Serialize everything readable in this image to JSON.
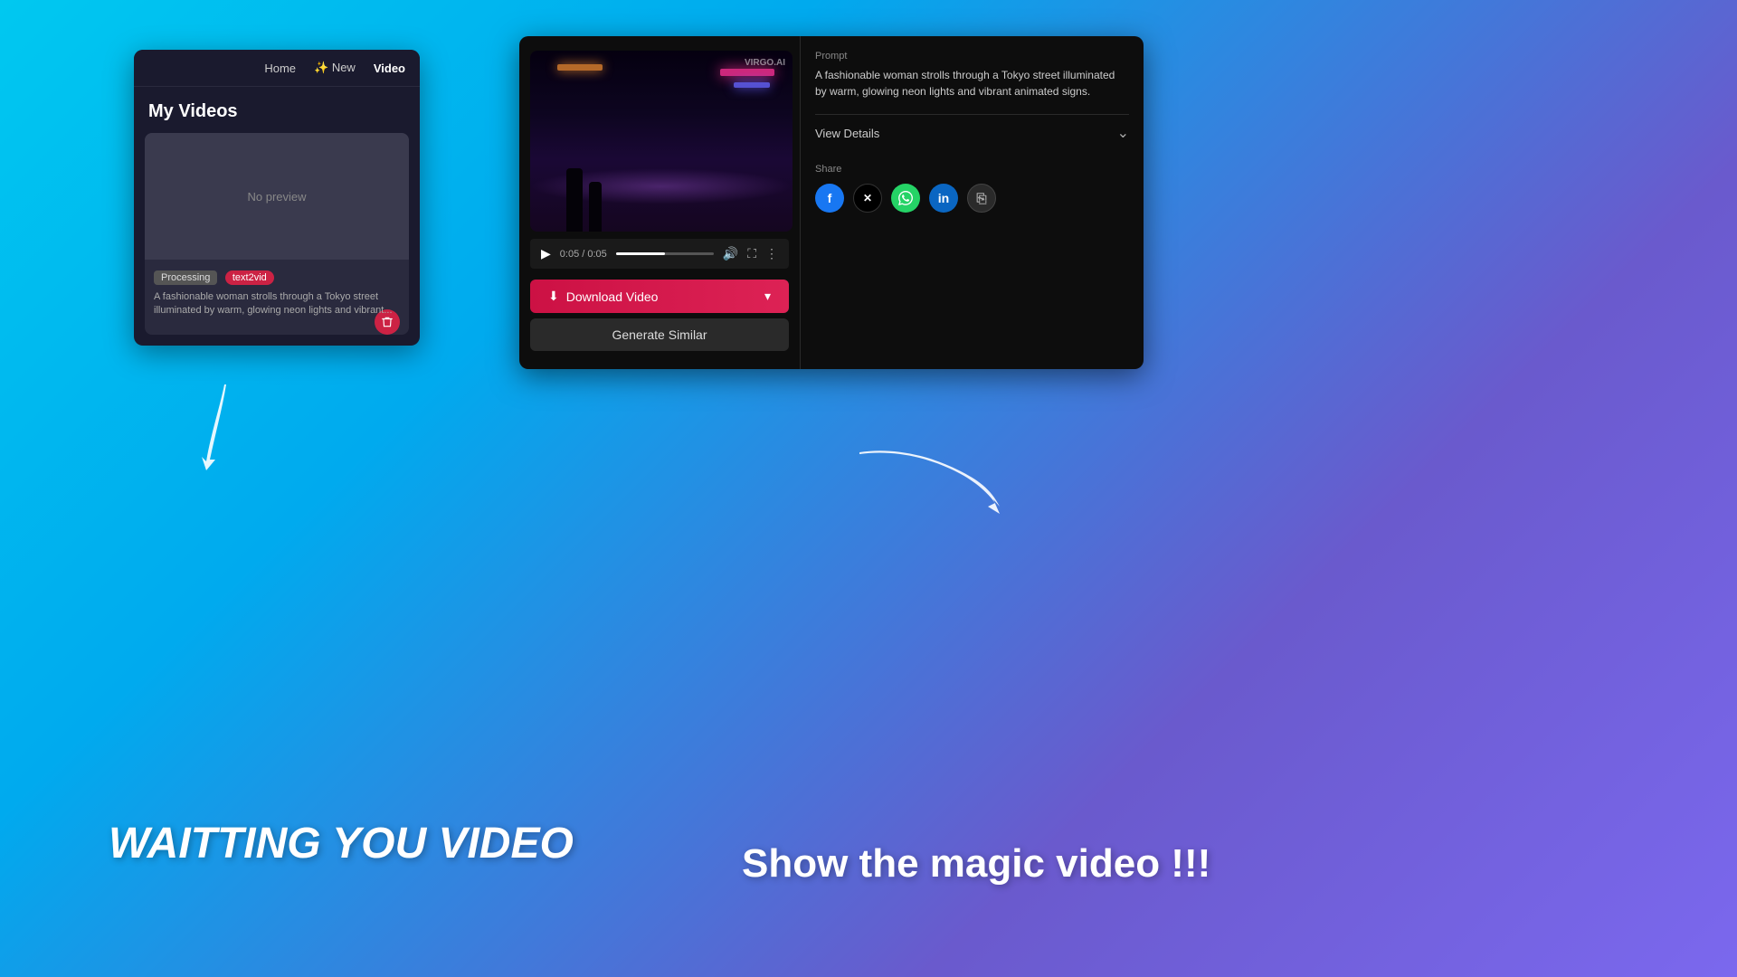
{
  "background": {
    "gradient_start": "#00c8f0",
    "gradient_end": "#7b68ee"
  },
  "left_panel": {
    "nav": {
      "home_label": "Home",
      "new_label": "✨ New",
      "video_label": "Video"
    },
    "title": "My Videos",
    "video_card": {
      "no_preview_label": "No preview",
      "status_badge": "Processing",
      "type_badge": "text2vid",
      "description": "A fashionable woman strolls through a Tokyo street illuminated by warm, glowing neon lights and vibrant..."
    }
  },
  "right_panel": {
    "prompt_label": "Prompt",
    "prompt_text": "A fashionable woman strolls through a Tokyo street illuminated by warm, glowing neon lights and vibrant animated signs.",
    "view_details_label": "View Details",
    "share_label": "Share",
    "time_display": "0:05 / 0:05",
    "download_button_label": "Download Video",
    "generate_similar_label": "Generate Similar",
    "watermark": "VIRGO.AI"
  },
  "bottom_labels": {
    "left_text": "WAITTING YOU VIDEO",
    "right_text": "Show the magic video !!!"
  },
  "share_icons": [
    {
      "name": "facebook",
      "label": "f"
    },
    {
      "name": "x-twitter",
      "label": "✕"
    },
    {
      "name": "whatsapp",
      "label": "W"
    },
    {
      "name": "linkedin",
      "label": "in"
    },
    {
      "name": "copy",
      "label": "⎘"
    }
  ]
}
